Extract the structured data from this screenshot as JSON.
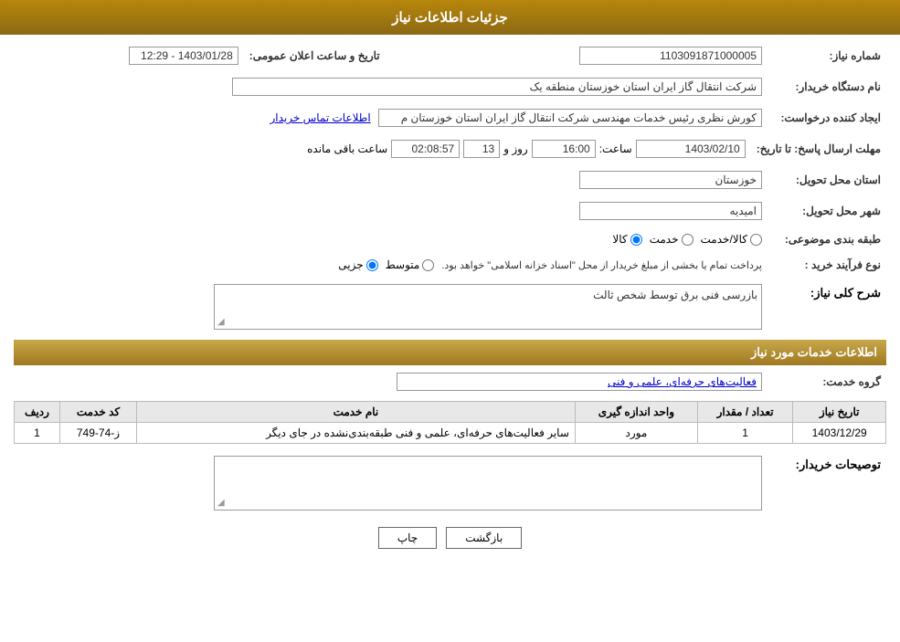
{
  "header": {
    "title": "جزئیات اطلاعات نیاز"
  },
  "fields": {
    "shomara_niaz_label": "شماره نیاز:",
    "shomara_niaz_value": "1103091871000005",
    "nam_dastgah_label": "نام دستگاه خریدار:",
    "nam_dastgah_value": "شرکت انتقال گاز ایران  استان خوزستان منطقه یک",
    "ijad_konande_label": "ایجاد کننده درخواست:",
    "ijad_konande_value": "کورش نظری رئیس خدمات مهندسی شرکت انتقال گاز ایران  استان خوزستان م",
    "ijad_konande_link": "اطلاعات تماس خریدار",
    "mohlet_ersal_label": "مهلت ارسال پاسخ: تا تاریخ:",
    "mohlet_date": "1403/02/10",
    "mohlet_saat_label": "ساعت:",
    "mohlet_saat": "16:00",
    "mohlet_rooz_label": "روز و",
    "mohlet_rooz": "13",
    "mohlet_baqi_label": "ساعت باقی مانده",
    "mohlet_baqi": "02:08:57",
    "ostan_tahvil_label": "استان محل تحویل:",
    "ostan_tahvil_value": "خوزستان",
    "shahr_tahvil_label": "شهر محل تحویل:",
    "shahr_tahvil_value": "امیدیه",
    "tabaqabandi_label": "طبقه بندی موضوعی:",
    "radio_kala": "کالا",
    "radio_khedmat": "خدمت",
    "radio_kala_khedmat": "کالا/خدمت",
    "nooe_farayand_label": "نوع فرآیند خرید :",
    "radio_jozii": "جزیی",
    "radio_motavaset": "متوسط",
    "radio_note": "پرداخت تمام یا بخشی از مبلغ خریدار از محل \"اسناد خزانه اسلامی\" خواهد بود.",
    "tarikh_elan_label": "تاریخ و ساعت اعلان عمومی:",
    "tarikh_elan_value": "1403/01/28 - 12:29",
    "sharh_section_title": "شرح کلی نیاز:",
    "sharh_value": "بازرسی فنی برق توسط شخص ثالث",
    "services_section_title": "اطلاعات خدمات مورد نیاز",
    "grooh_khedmat_label": "گروه خدمت:",
    "grooh_khedmat_value": "فعالیت‌های حرفه‌ای، علمی و فنی",
    "table": {
      "col_radif": "ردیف",
      "col_kod": "کد خدمت",
      "col_nam": "نام خدمت",
      "col_vahed": "واحد اندازه گیری",
      "col_tedad": "تعداد / مقدار",
      "col_tarikh": "تاریخ نیاز",
      "rows": [
        {
          "radif": "1",
          "kod": "ز-74-749",
          "nam": "سایر فعالیت‌های حرفه‌ای، علمی و فنی طبقه‌بندی‌نشده در جای دیگر",
          "vahed": "مورد",
          "tedad": "1",
          "tarikh": "1403/12/29"
        }
      ]
    },
    "tosih_label": "توصیحات خریدار:"
  },
  "buttons": {
    "print": "چاپ",
    "back": "بازگشت"
  }
}
